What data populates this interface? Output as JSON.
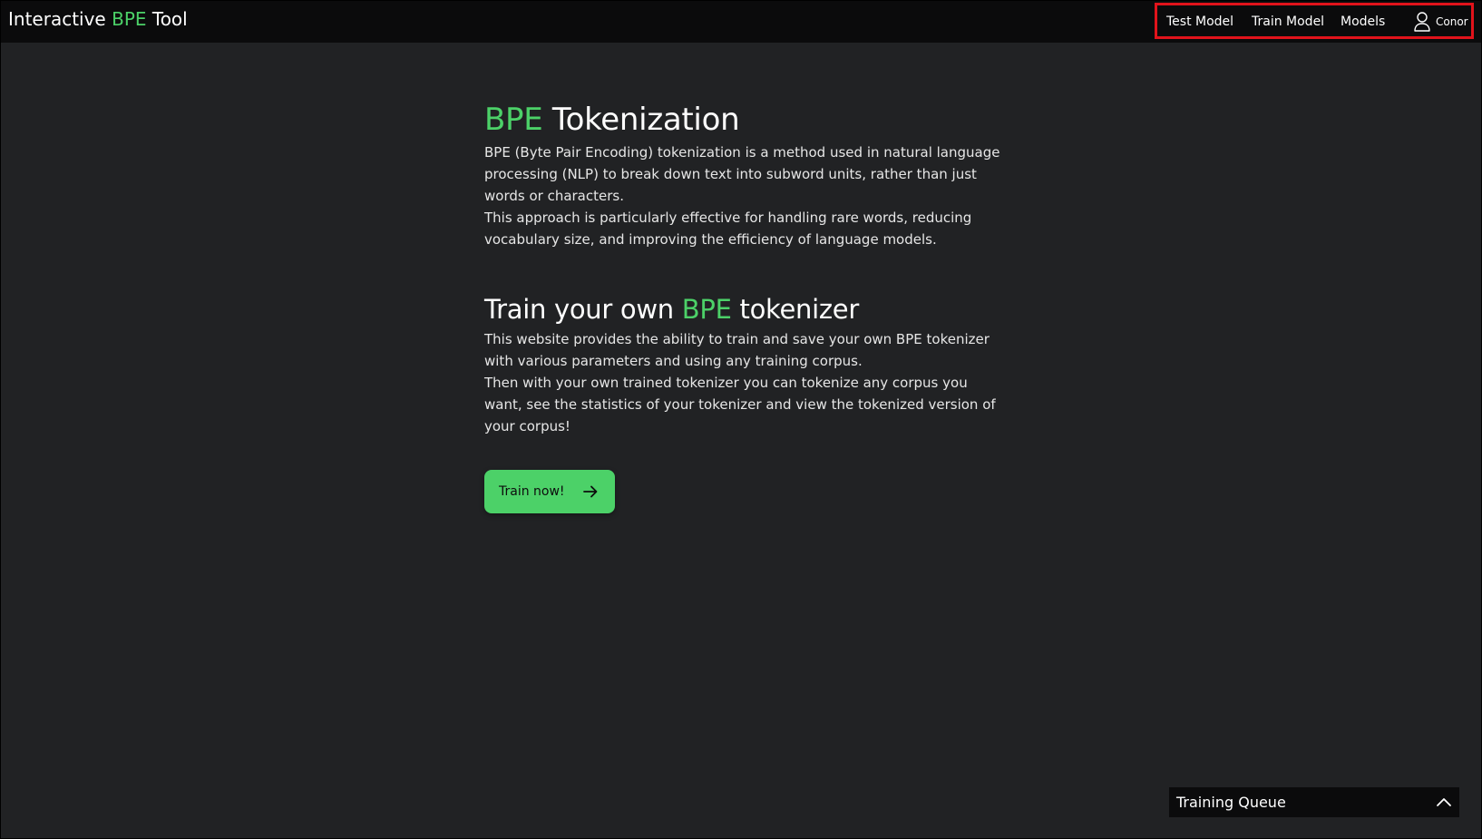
{
  "header": {
    "brand": {
      "part1": "Interactive ",
      "highlight": "BPE",
      "part2": " Tool"
    },
    "nav": {
      "test_model": "Test Model",
      "train_model": "Train Model",
      "models": "Models",
      "user_name": "Conor",
      "user_icon": "user-icon"
    }
  },
  "main": {
    "hero": {
      "highlight": "BPE",
      "rest": " Tokenization"
    },
    "intro_p1": "BPE (Byte Pair Encoding) tokenization is a method used in natural language processing (NLP) to break down text into subword units, rather than just words or characters.",
    "intro_p2": "This approach is particularly effective for handling rare words, reducing vocabulary size, and improving the efficiency of language models.",
    "section": {
      "part1": "Train your own ",
      "highlight": "BPE",
      "part2": " tokenizer"
    },
    "train_p1": "This website provides the ability to train and save your own BPE tokenizer with various parameters and using any training corpus.",
    "train_p2": "Then with your own trained tokenizer you can tokenize any corpus you want, see the statistics of your tokenizer and view the tokenized version of your corpus!",
    "cta_label": "Train now!",
    "cta_icon": "arrow-right-icon"
  },
  "queue": {
    "label": "Training Queue",
    "icon": "chevron-up-icon"
  },
  "colors": {
    "accent": "#4cd168",
    "background": "#212224",
    "header_bg": "#0b0b0c",
    "highlight_border": "#e1131b"
  }
}
